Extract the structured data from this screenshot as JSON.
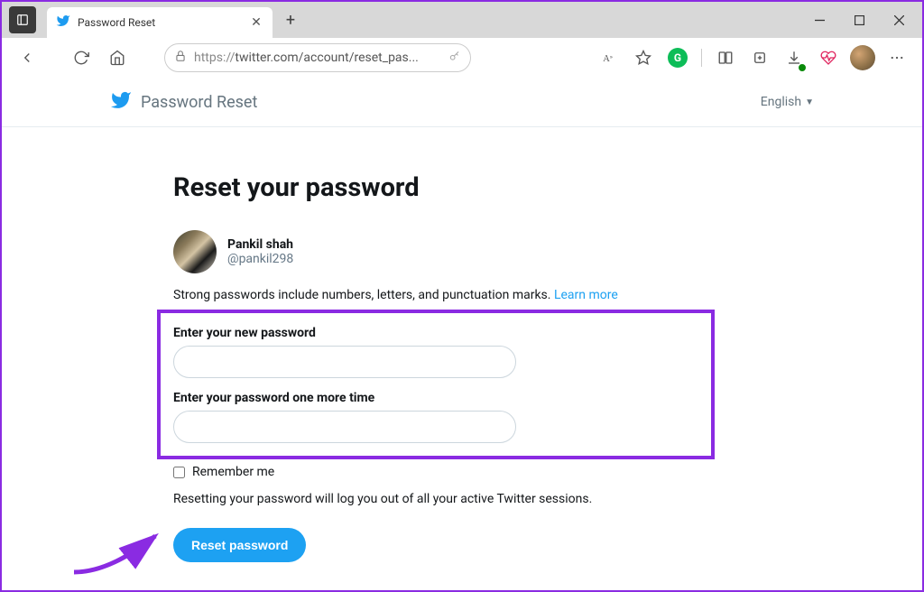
{
  "browser": {
    "tab_title": "Password Reset",
    "url_display": "https://twitter.com/account/reset_pas...",
    "url_https": "https://"
  },
  "header": {
    "title": "Password Reset",
    "language": "English"
  },
  "page": {
    "heading": "Reset your password",
    "user": {
      "display_name": "Pankil shah",
      "handle": "@pankil298"
    },
    "hint_text": "Strong passwords include numbers, letters, and punctuation marks. ",
    "hint_link": "Learn more",
    "field1_label": "Enter your new password",
    "field2_label": "Enter your password one more time",
    "remember_label": "Remember me",
    "session_note": "Resetting your password will log you out of all your active Twitter sessions.",
    "submit_label": "Reset password"
  }
}
